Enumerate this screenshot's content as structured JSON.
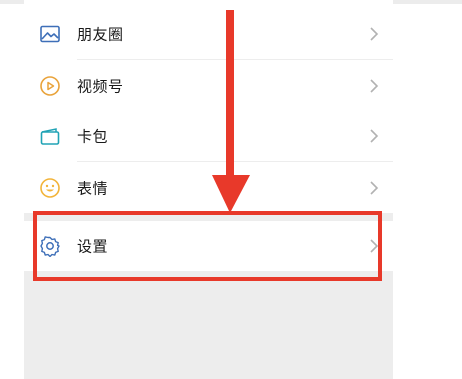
{
  "menu": {
    "items": [
      {
        "label": "朋友圈",
        "icon": "moments-icon"
      },
      {
        "label": "视频号",
        "icon": "channels-icon"
      },
      {
        "label": "卡包",
        "icon": "card-wallet-icon"
      },
      {
        "label": "表情",
        "icon": "emoji-icon"
      },
      {
        "label": "设置",
        "icon": "settings-icon"
      }
    ]
  },
  "colors": {
    "highlight": "#e8392a",
    "icon_blue": "#3e6fb8",
    "icon_orange": "#e9a33b",
    "icon_teal": "#20a3b5",
    "icon_yellow": "#f2b43a",
    "background_gray": "#ededed"
  }
}
